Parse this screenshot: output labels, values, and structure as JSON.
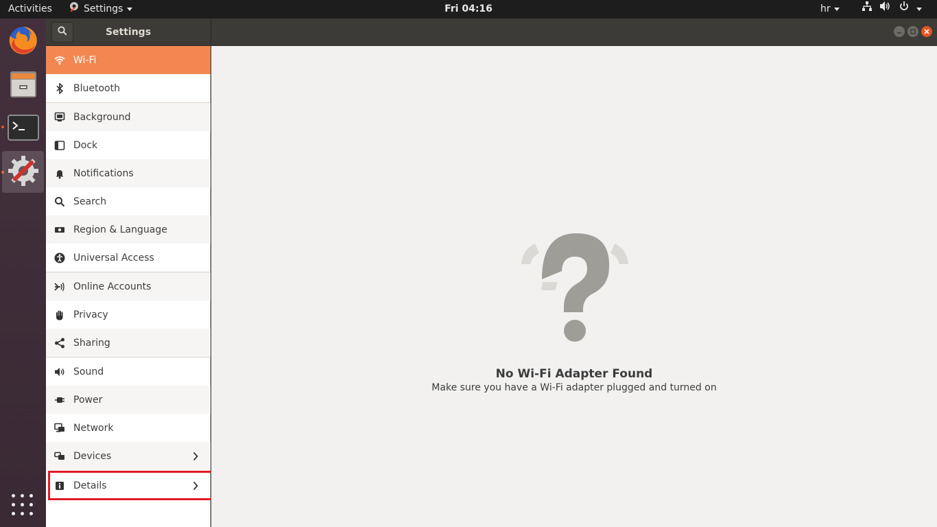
{
  "topbar": {
    "activities": "Activities",
    "app_menu": "Settings",
    "clock": "Fri 04:16",
    "keyboard_layout": "hr"
  },
  "dock": {
    "apps": [
      {
        "name": "firefox-icon"
      },
      {
        "name": "files-icon"
      },
      {
        "name": "terminal-icon"
      },
      {
        "name": "settings-icon"
      }
    ]
  },
  "header": {
    "title": "Settings"
  },
  "sidebar": {
    "items": [
      {
        "label": "Wi-Fi",
        "icon": "wifi-icon",
        "selected": true
      },
      {
        "label": "Bluetooth",
        "icon": "bluetooth-icon"
      },
      {
        "label": "Background",
        "icon": "background-icon"
      },
      {
        "label": "Dock",
        "icon": "dock-icon"
      },
      {
        "label": "Notifications",
        "icon": "bell-icon"
      },
      {
        "label": "Search",
        "icon": "search-icon"
      },
      {
        "label": "Region & Language",
        "icon": "region-icon"
      },
      {
        "label": "Universal Access",
        "icon": "accessibility-icon"
      },
      {
        "label": "Online Accounts",
        "icon": "online-accounts-icon"
      },
      {
        "label": "Privacy",
        "icon": "hand-icon"
      },
      {
        "label": "Sharing",
        "icon": "share-icon"
      },
      {
        "label": "Sound",
        "icon": "speaker-icon"
      },
      {
        "label": "Power",
        "icon": "power-plug-icon"
      },
      {
        "label": "Network",
        "icon": "network-icon"
      },
      {
        "label": "Devices",
        "icon": "devices-icon",
        "has_submenu": true
      },
      {
        "label": "Details",
        "icon": "info-icon",
        "has_submenu": true
      }
    ]
  },
  "content": {
    "title": "No Wi-Fi Adapter Found",
    "subtitle": "Make sure you have a Wi-Fi adapter plugged and turned on"
  },
  "colors": {
    "accent": "#f38752",
    "highlight_box": "#e01b24",
    "close_button": "#e95420"
  }
}
